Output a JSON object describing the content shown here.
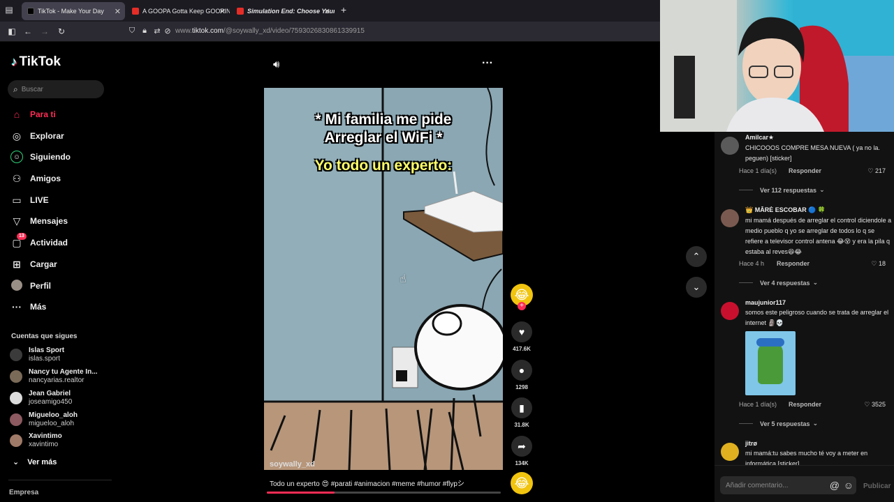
{
  "browser": {
    "tabs": [
      {
        "title": "TikTok - Make Your Day",
        "active": true
      },
      {
        "title": "A GOOPA Gotta Keep GOOPIN"
      },
      {
        "title": "Simulation End: Choose Your"
      }
    ],
    "new_tab": "+",
    "url_prefix": "www.",
    "url_domain": "tiktok.com",
    "url_path": "/@soywally_xd/video/7593026830861339915"
  },
  "sidebar": {
    "logo": "TikTok",
    "search_placeholder": "Buscar",
    "nav": [
      {
        "label": "Para ti",
        "icon": "home-icon",
        "active": true
      },
      {
        "label": "Explorar",
        "icon": "compass-icon"
      },
      {
        "label": "Siguiendo",
        "icon": "following-icon"
      },
      {
        "label": "Amigos",
        "icon": "friends-icon"
      },
      {
        "label": "LIVE",
        "icon": "live-icon"
      },
      {
        "label": "Mensajes",
        "icon": "send-icon"
      },
      {
        "label": "Actividad",
        "icon": "activity-icon",
        "badge": "13"
      },
      {
        "label": "Cargar",
        "icon": "upload-icon"
      },
      {
        "label": "Perfil",
        "icon": "profile-avatar"
      },
      {
        "label": "Más",
        "icon": "more-icon"
      }
    ],
    "following_title": "Cuentas que sigues",
    "following": [
      {
        "name": "Islas Sport",
        "handle": "islas.sport"
      },
      {
        "name": "Nancy tu Agente In...",
        "handle": "nancyarias.realtor"
      },
      {
        "name": "Jean Gabriel",
        "handle": "joseamigo450"
      },
      {
        "name": "Migueloo_aloh",
        "handle": "migueloo_aloh"
      },
      {
        "name": "Xavintimo",
        "handle": "xavintimo"
      }
    ],
    "see_more": "Ver más",
    "company": "Empresa"
  },
  "video": {
    "caption_line1": "* Mi familia me pide",
    "caption_line2": "Arreglar el WiFi *",
    "caption_yellow": "Yo todo un experto:",
    "username": "soywally_xd",
    "description": "Todo un experto 😍 #parati #animacion #meme #humor #flypシ",
    "progress": 0.29
  },
  "actions": {
    "likes": "417.6K",
    "comments": "1298",
    "saves": "31.8K",
    "shares": "134K"
  },
  "comments": [
    {
      "user": "Amilcar★",
      "text": "CHICOOOS COMPRE MESA NUEVA ( ya no la. peguen) [sticker]",
      "time": "Hace 1 día(s)",
      "reply": "Responder",
      "likes": "217",
      "more": "Ver 112 respuestas"
    },
    {
      "user": "👑 MĀRĖ ESCOBAR 🔵 🍀",
      "text": "mi mamá después de arreglar el control diciendole a medio pueblo q yo se arreglar de todos lo q se refiere a televisor control antena 😂😵 y era la pila q estaba al reves😆😂",
      "time": "Hace 4 h",
      "reply": "Responder",
      "likes": "18",
      "more": "Ver 4 respuestas"
    },
    {
      "user": "maujunior117",
      "text": "somos este peligroso cuando se trata de arreglar el internet 🗿💀",
      "time": "Hace 1 día(s)",
      "reply": "Responder",
      "likes": "3525",
      "more": "Ver 5 respuestas"
    },
    {
      "user": "jitrø",
      "text": "mi mamá:tu sabes mucho té voy a meter en informática [sticker]"
    }
  ],
  "comment_input_placeholder": "Añadir comentario...",
  "publish_label": "Publicar",
  "colors": {
    "accent": "#fe2c55",
    "caption_yellow": "#ffff6a"
  }
}
